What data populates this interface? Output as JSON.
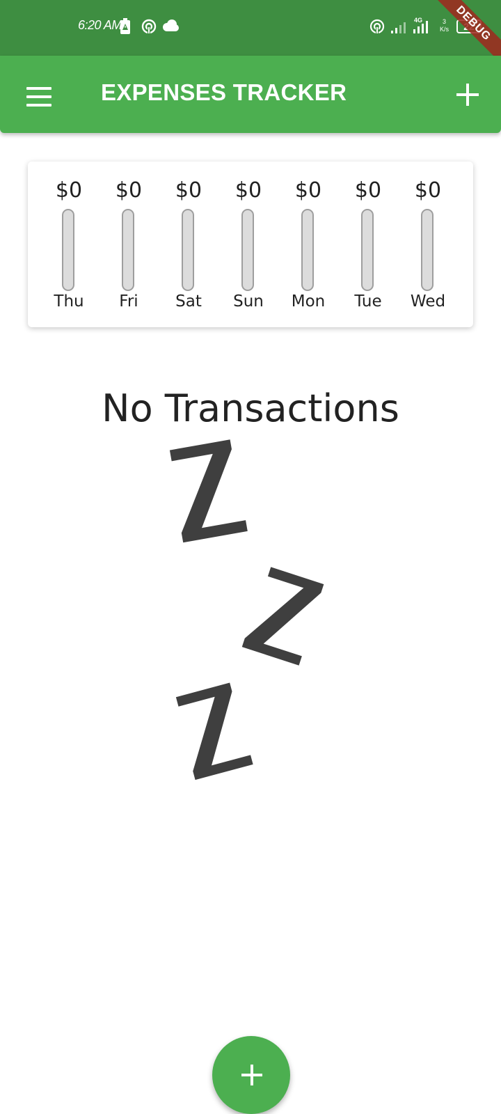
{
  "status_bar": {
    "time": "6:20 AM",
    "network_type": "4G",
    "speed_value": "3",
    "speed_unit": "K/s",
    "battery_level": "22",
    "debug_banner": "DEBUG",
    "icons": [
      "battery-alert-icon",
      "hotspot-icon",
      "cloud-icon",
      "hotspot-icon",
      "signal-icon",
      "signal-icon"
    ]
  },
  "app_bar": {
    "title": "EXPENSES TRACKER",
    "menu_icon": "menu-icon",
    "add_icon": "plus-icon",
    "background": "#4caf50"
  },
  "chart": {
    "days": [
      {
        "label": "Thu",
        "amount": "$0",
        "spending_fraction": 0
      },
      {
        "label": "Fri",
        "amount": "$0",
        "spending_fraction": 0
      },
      {
        "label": "Sat",
        "amount": "$0",
        "spending_fraction": 0
      },
      {
        "label": "Sun",
        "amount": "$0",
        "spending_fraction": 0
      },
      {
        "label": "Mon",
        "amount": "$0",
        "spending_fraction": 0
      },
      {
        "label": "Tue",
        "amount": "$0",
        "spending_fraction": 0
      },
      {
        "label": "Wed",
        "amount": "$0",
        "spending_fraction": 0
      }
    ],
    "bar_empty_color": "#dcdcdc",
    "bar_fill_color": "#4caf50"
  },
  "empty_state": {
    "title": "No Transactions",
    "illustration": "sleeping-zzz-icon"
  },
  "fab": {
    "icon": "plus-icon",
    "color": "#4caf50"
  }
}
